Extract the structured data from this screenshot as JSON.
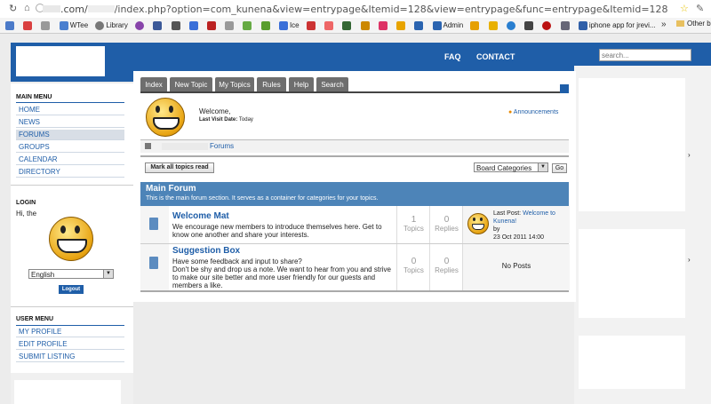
{
  "browser": {
    "url_host": ".com/",
    "url_path": "/index.php?option=com_kunena&view=entrypage&Itemid=128&view=entrypage&func=entrypage&Itemid=128",
    "bookmarks": [
      {
        "label": "WTee",
        "color": "#4a7fcf"
      },
      {
        "label": "Library",
        "color": "#777777"
      },
      {
        "label": "Ice",
        "color": "#3a6fd8"
      },
      {
        "label": "Admin",
        "color": "#2b64b0"
      },
      {
        "label": "iphone app for jrevi...",
        "color": "#2f5fa8"
      }
    ],
    "other_bookmarks": "Other b",
    "more_chevron": "»"
  },
  "header": {
    "faq": "FAQ",
    "contact": "CONTACT",
    "search_placeholder": "search..."
  },
  "main_menu": {
    "title": "MAIN MENU",
    "items": [
      "HOME",
      "NEWS",
      "FORUMS",
      "GROUPS",
      "CALENDAR",
      "DIRECTORY"
    ],
    "active": "FORUMS"
  },
  "login": {
    "title": "LOGIN",
    "greeting": "Hi, the",
    "language": "English",
    "logout": "Logout"
  },
  "user_menu": {
    "title": "USER MENU",
    "items": [
      "MY PROFILE",
      "EDIT PROFILE",
      "SUBMIT LISTING"
    ]
  },
  "tabs": [
    "Index",
    "New Topic",
    "My Topics",
    "Rules",
    "Help",
    "Search"
  ],
  "welcome": {
    "text": "Welcome,",
    "last_visit_label": "Last Visit Date:",
    "last_visit_value": "Today",
    "announcements": "Announcements"
  },
  "breadcrumb": {
    "forums": "Forums"
  },
  "actions": {
    "mark_all": "Mark all topics read",
    "board_categories": "Board Categories",
    "go": "Go"
  },
  "category": {
    "title": "Main Forum",
    "description": "This is the main forum section. It serves as a container for categories for your topics."
  },
  "forums": [
    {
      "title": "Welcome Mat",
      "desc": "We encourage new members to introduce themselves here. Get to know one another and share your interests.",
      "topics": "1",
      "topics_label": "Topics",
      "replies": "0",
      "replies_label": "Replies",
      "last_post_label": "Last Post:",
      "last_post_link": "Welcome to Kunena!",
      "by": "by",
      "date": "23 Oct 2011 14:00"
    },
    {
      "title": "Suggestion Box",
      "desc1": "Have some feedback and input to share?",
      "desc2": "Don't be shy and drop us a note. We want to hear from you and strive to make our site better and more user friendly for our guests and members a like.",
      "topics": "0",
      "topics_label": "Topics",
      "replies": "0",
      "replies_label": "Replies",
      "no_posts": "No Posts"
    }
  ],
  "colors": {
    "brand": "#1f5ea8",
    "category_bar": "#4d84b8",
    "tab": "#6e6e6e"
  }
}
